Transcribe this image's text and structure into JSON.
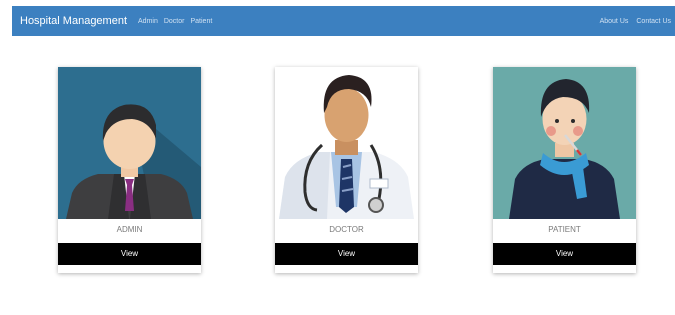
{
  "navbar": {
    "brand": "Hospital Management",
    "links": [
      "Admin",
      "Doctor",
      "Patient"
    ],
    "right_links": [
      "About Us",
      "Contact Us"
    ],
    "background": "#3c80c0"
  },
  "cards": [
    {
      "label": "ADMIN",
      "button": "View",
      "icon": "admin-avatar-icon",
      "background": "#2d6e8f"
    },
    {
      "label": "DOCTOR",
      "button": "View",
      "icon": "doctor-avatar-icon",
      "background": "#ffffff"
    },
    {
      "label": "PATIENT",
      "button": "View",
      "icon": "patient-avatar-icon",
      "background": "#6aaaa8"
    }
  ]
}
